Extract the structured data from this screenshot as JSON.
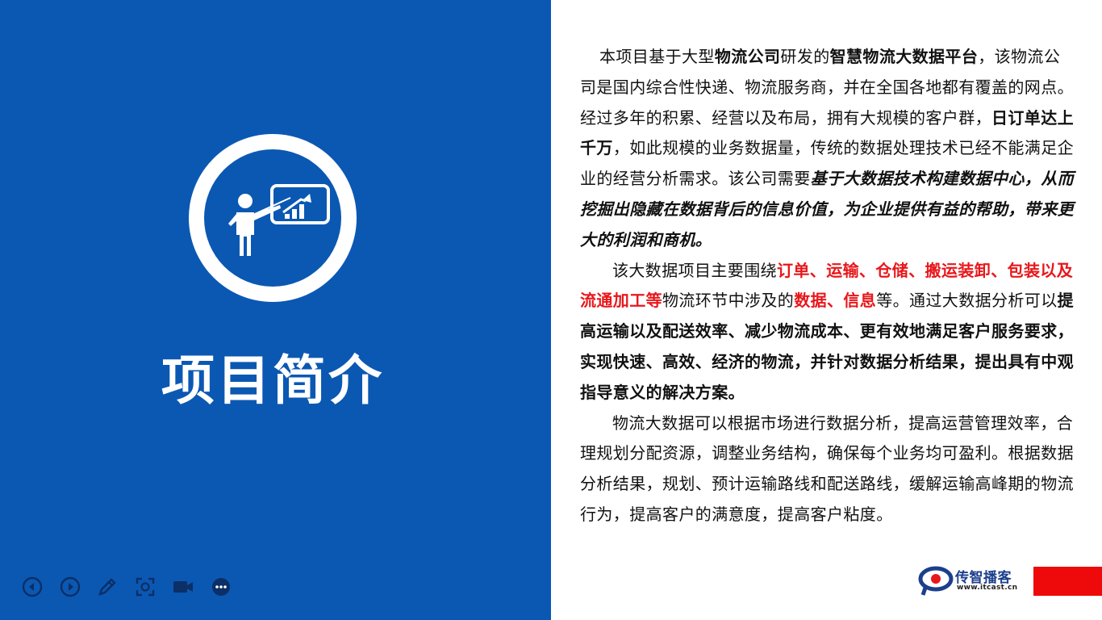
{
  "slide": {
    "title": "项目简介",
    "colors": {
      "panel": "#0b58b3",
      "accent_red": "#e8171b",
      "brand_red": "#ee0a0a"
    },
    "icon": "presenter-chart-icon"
  },
  "paragraphs": {
    "p1": {
      "s1": "本项目基于大型",
      "s2": "物流公司",
      "s3": "研发的",
      "s4": "智慧物流大数据平台",
      "s5": "，该物流公司是国内综合性快递、物流服务商，并在全国各地都有覆盖的网点。经过多年的积累、经营以及布局，拥有大规模的客户群，",
      "s6": "日订单达上千万",
      "s7": "，如此规模的业务数据量，传统的数据处理技术已经不能满足企业的经营分析需求。该公司需要",
      "s8": "基于大数据技术构建数据中心，从而挖掘出隐藏在数据背后的信息价值，为企业提供有益的帮助，带来更大的利润和商机。"
    },
    "p2": {
      "s1": "该大数据项目主要围绕",
      "s2": "订单、运输、仓储、搬运装卸、包装以及流通加工等",
      "s3": "物流环节中涉及的",
      "s4": "数据、信息",
      "s5": "等。通过大数据分析可以",
      "s6": "提高运输以及配送效率、减少物流成本、更有效地满足客户服务要求，实现快速、高效、经济的物流，并针对数据分析结果，提出具有中观指导意义的解决方案。"
    },
    "p3": {
      "s1": "物流大数据可以根据市场进行数据分析，提高运营管理效率，合理规划分配资源，调整业务结构，确保每个业务均可盈利。根据数据分析结果，规划、预计运输路线和配送路线，缓解运输高峰期的物流行为，提高客户的满意度，提高客户粘度。"
    }
  },
  "toolbar": {
    "icons": [
      "previous-icon",
      "next-icon",
      "pen-icon",
      "zoom-icon",
      "camera-icon",
      "more-icon"
    ]
  },
  "brand": {
    "name": "传智播客",
    "url": "www.itcast.cn"
  }
}
